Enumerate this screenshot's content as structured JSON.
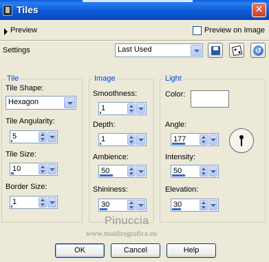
{
  "window": {
    "title": "Tiles"
  },
  "preview": {
    "label": "Preview",
    "checkbox_label": "Preview on Image",
    "checked": false
  },
  "settings": {
    "label": "Settings",
    "preset": "Last Used"
  },
  "groups": {
    "tile": {
      "title": "Tile",
      "shape_label": "Tile Shape:",
      "shape_value": "Hexagon",
      "angularity_label": "Tile Angularity:",
      "angularity_value": "5",
      "angularity_level": 0.05,
      "size_label": "Tile Size:",
      "size_value": "10",
      "size_level": 0.1,
      "border_label": "Border Size:",
      "border_value": "1",
      "border_level": 0.05
    },
    "image": {
      "title": "Image",
      "smoothness_label": "Smoothness:",
      "smoothness_value": "1",
      "smoothness_level": 0.05,
      "depth_label": "Depth:",
      "depth_value": "1",
      "depth_level": 0.05,
      "ambience_label": "Ambience:",
      "ambience_value": "50",
      "ambience_level": 0.5,
      "shininess_label": "Shininess:",
      "shininess_value": "30",
      "shininess_level": 0.3
    },
    "light": {
      "title": "Light",
      "color_label": "Color:",
      "color_value": "#ffffff",
      "angle_label": "Angle:",
      "angle_value": "177",
      "angle_level": 0.49,
      "intensity_label": "Intensity:",
      "intensity_value": "50",
      "intensity_level": 0.5,
      "elevation_label": "Elevation:",
      "elevation_value": "30",
      "elevation_level": 0.33
    }
  },
  "watermark": {
    "line1": "Pinuccia",
    "line2": "www.maidiregrafica.eu"
  },
  "buttons": {
    "ok": "OK",
    "cancel": "Cancel",
    "help": "Help"
  },
  "colors": {
    "titlebar": "#0b5bd6",
    "group_title": "#0046d5",
    "slider": "#316ac5",
    "background": "#ece9d8"
  }
}
